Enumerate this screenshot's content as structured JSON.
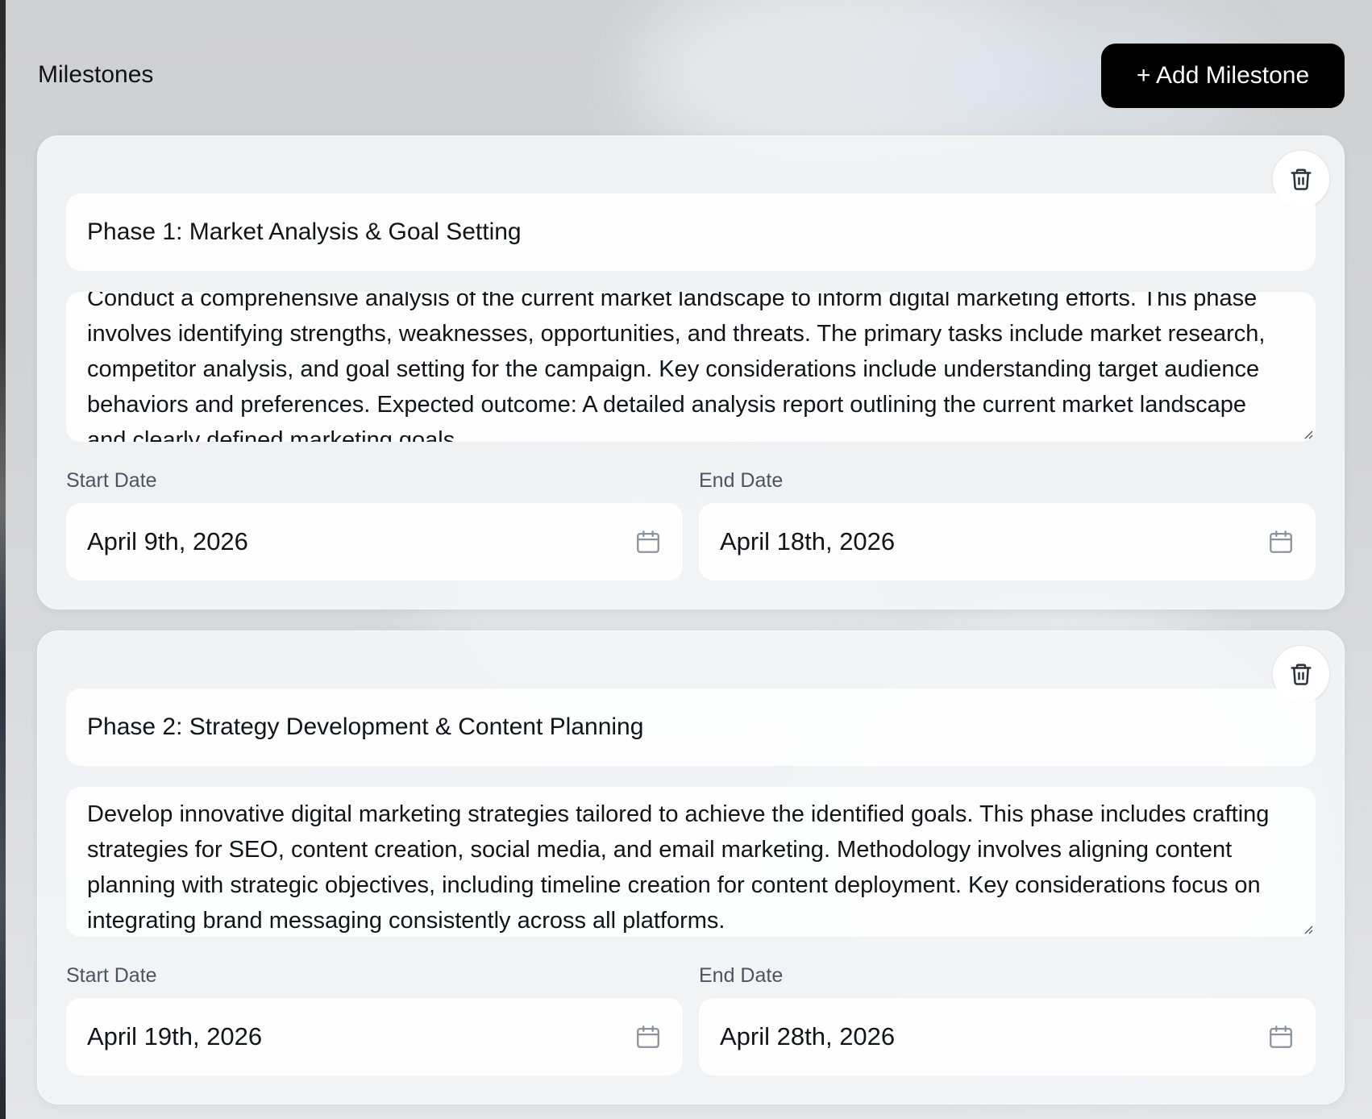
{
  "header": {
    "title": "Milestones",
    "add_button_label": "+ Add Milestone"
  },
  "milestones": [
    {
      "title": "Phase 1: Market Analysis & Goal Setting",
      "description": "Conduct a comprehensive analysis of the current market landscape to inform digital marketing efforts. This phase involves identifying strengths, weaknesses, opportunities, and threats. The primary tasks include market research, competitor analysis, and goal setting for the campaign. Key considerations include understanding target audience behaviors and preferences. Expected outcome: A detailed analysis report outlining the current market landscape and clearly defined marketing goals.",
      "start_label": "Start Date",
      "start_date": "April 9th, 2026",
      "end_label": "End Date",
      "end_date": "April 18th, 2026"
    },
    {
      "title": "Phase 2: Strategy Development & Content Planning",
      "description": "Develop innovative digital marketing strategies tailored to achieve the identified goals. This phase includes crafting strategies for SEO, content creation, social media, and email marketing. Methodology involves aligning content planning with strategic objectives, including timeline creation for content deployment. Key considerations focus on integrating brand messaging consistently across all platforms.",
      "start_label": "Start Date",
      "start_date": "April 19th, 2026",
      "end_label": "End Date",
      "end_date": "April 28th, 2026"
    }
  ],
  "icons": {
    "delete": "trash-icon",
    "calendar": "calendar-icon",
    "resize": "resize-handle-icon"
  },
  "colors": {
    "primary_button": "#000000",
    "label_text": "#4a5564",
    "card_background": "#f4f5f7"
  }
}
